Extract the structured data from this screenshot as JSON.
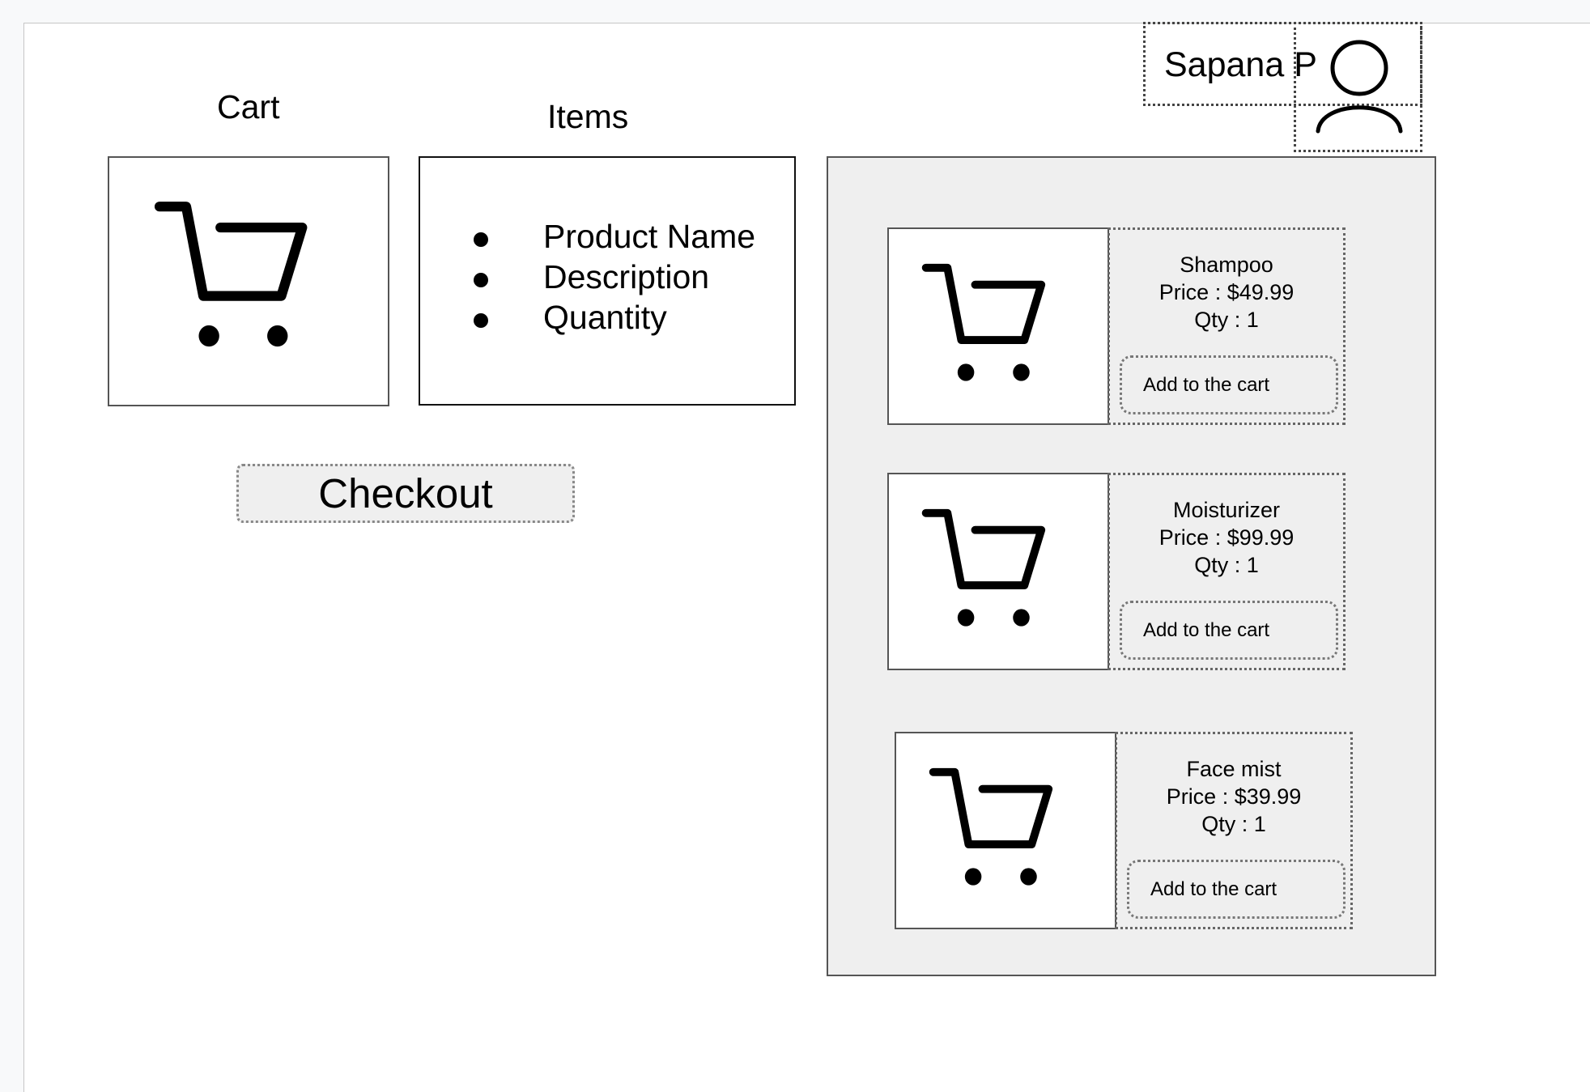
{
  "user": {
    "name": "Sapana P"
  },
  "cart_section": {
    "title": "Cart"
  },
  "items_section": {
    "title": "Items",
    "fields": [
      "Product Name",
      "Description",
      "Quantity"
    ]
  },
  "checkout": {
    "label": "Checkout"
  },
  "products": [
    {
      "name": "Shampoo",
      "price": "Price : $49.99",
      "qty": "Qty : 1",
      "add_label": "Add to the cart"
    },
    {
      "name": "Moisturizer",
      "price": "Price : $99.99",
      "qty": "Qty : 1",
      "add_label": "Add to the cart"
    },
    {
      "name": "Face mist",
      "price": "Price : $39.99",
      "qty": "Qty : 1",
      "add_label": "Add to the cart"
    }
  ],
  "icons": {
    "cart": "shopping-cart-icon",
    "user": "user-avatar-icon"
  }
}
